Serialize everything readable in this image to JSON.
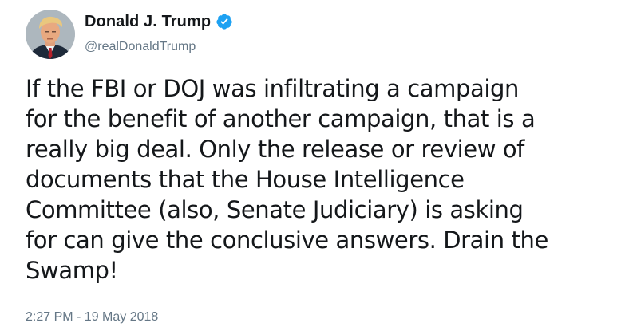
{
  "tweet": {
    "author": {
      "display_name": "Donald J. Trump",
      "handle": "@realDonaldTrump",
      "verified": true,
      "avatar_icon": "profile-photo",
      "verified_icon": "verified-badge-icon"
    },
    "text_lines": [
      "If the FBI or DOJ was infiltrating a campaign",
      "for the benefit of another campaign, that is a",
      "really big deal. Only the release or review of",
      "documents that the House Intelligence",
      "Committee (also, Senate Judiciary) is asking",
      "for can give the conclusive answers. Drain the",
      "Swamp!"
    ],
    "timestamp": "2:27 PM - 19 May 2018"
  },
  "colors": {
    "text_primary": "#14171a",
    "text_secondary": "#657786",
    "verified_blue": "#1da1f2",
    "background": "#ffffff"
  }
}
